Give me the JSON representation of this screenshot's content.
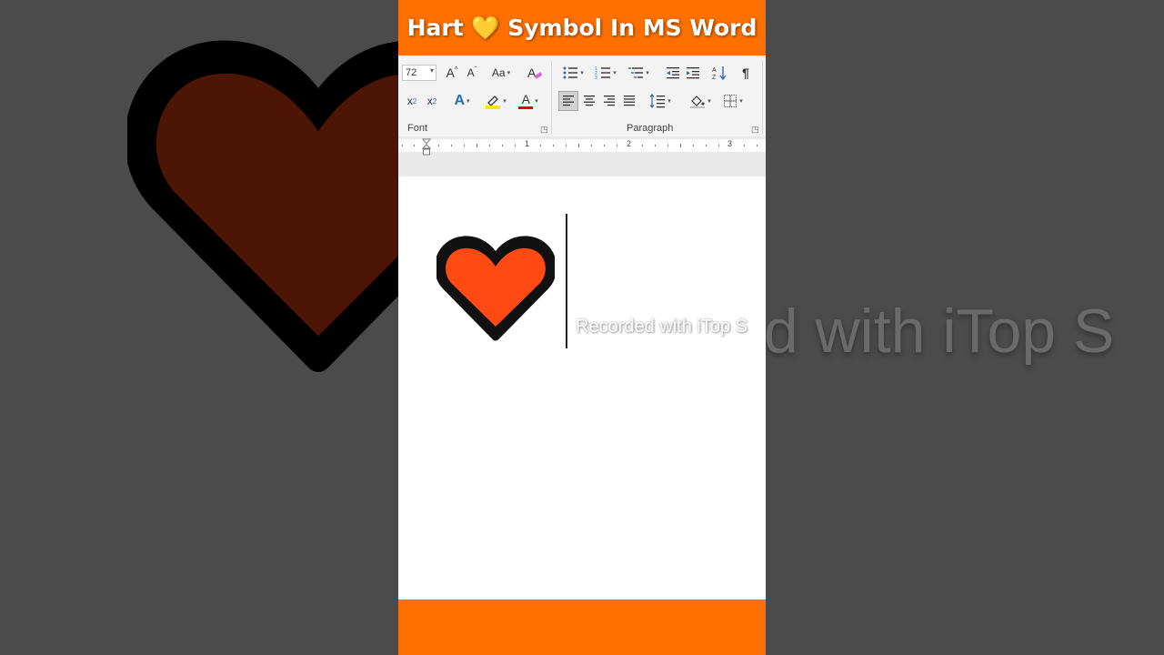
{
  "title": {
    "text_before": "Hart",
    "emoji": "💛",
    "text_after": "Symbol In MS Word"
  },
  "ribbon": {
    "font_size": "72",
    "font_group_label": "Font",
    "paragraph_group_label": "Paragraph",
    "change_case_label": "Aa",
    "grow_font_label": "A",
    "shrink_font_label": "A",
    "text_effects_label": "A",
    "font_color_label": "A",
    "pilcrow_label": "¶",
    "subscript_label": "x",
    "subscript_mark": "2",
    "superscript_label": "x",
    "superscript_mark": "2"
  },
  "ruler": {
    "numbers": [
      "1",
      "2",
      "3"
    ]
  },
  "document": {
    "symbol": "heart",
    "watermark": "Recorded with iTop S"
  },
  "background": {
    "watermark": "ed with iTop S"
  },
  "colors": {
    "brand_orange": "#ff7000",
    "heart_fill": "#ff4a14",
    "heart_outline": "#111111",
    "highlight_yellow": "#ffe600",
    "font_color_red": "#e00000",
    "accent_blue": "#2b6cb0"
  }
}
